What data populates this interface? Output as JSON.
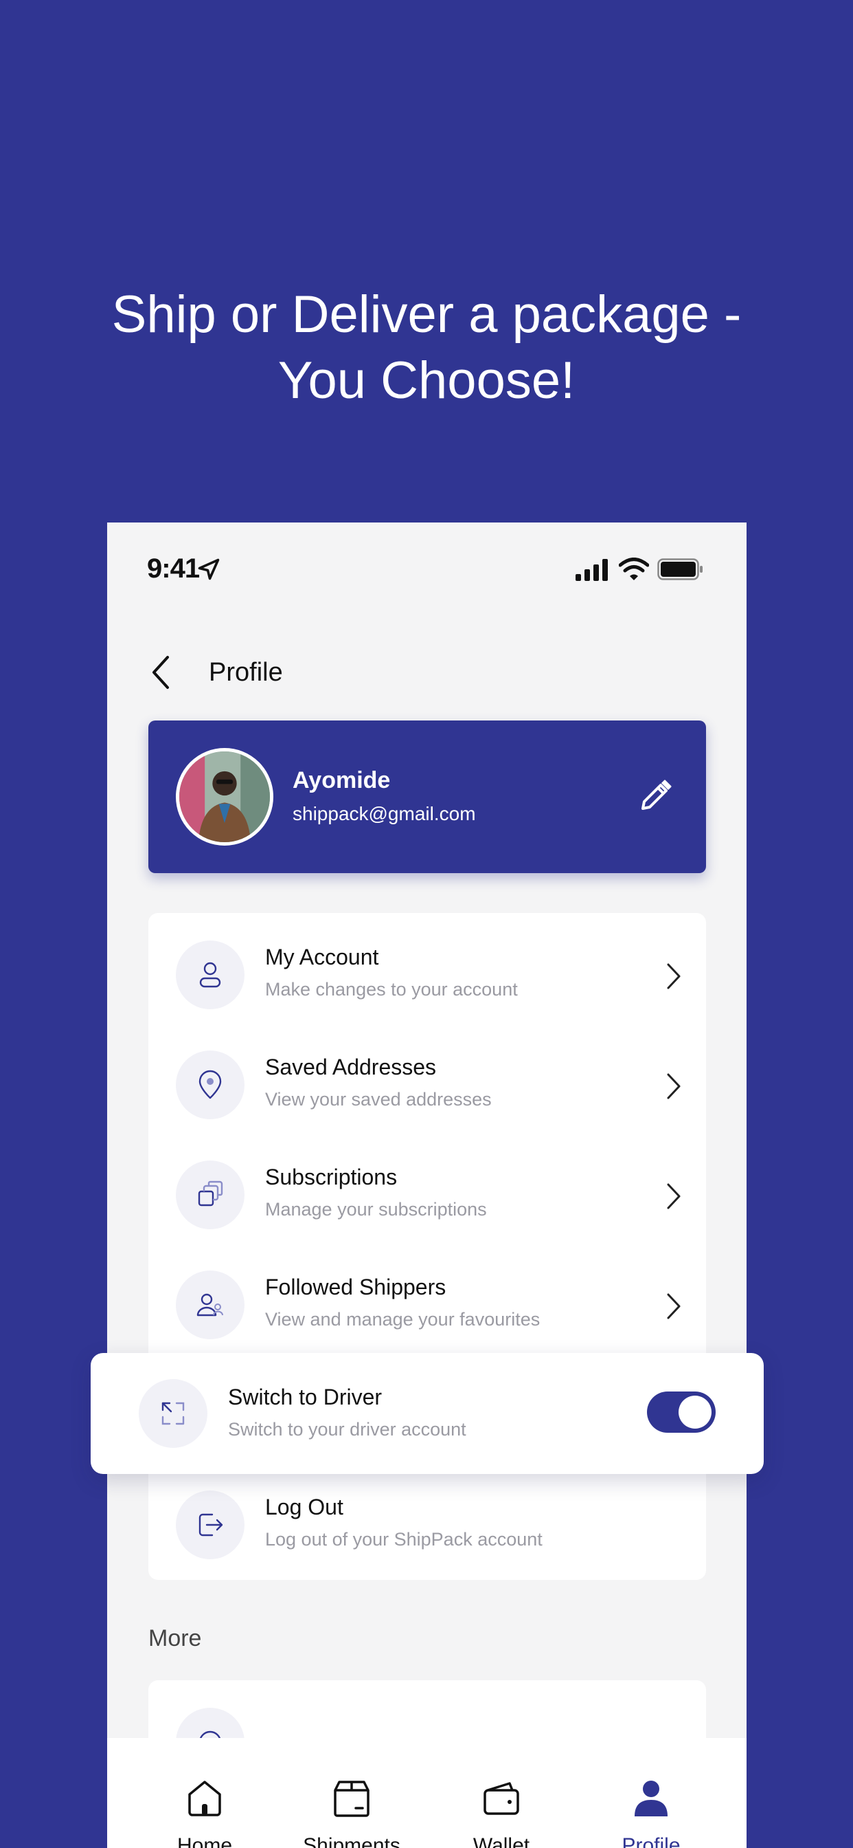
{
  "headline": {
    "line1": "Ship or Deliver a package -",
    "line2": "You Choose!"
  },
  "status_bar": {
    "time": "9:41",
    "icons": [
      "location-arrow-icon",
      "signal-icon",
      "wifi-icon",
      "battery-icon"
    ]
  },
  "navbar": {
    "back_icon": "chevron-left-icon",
    "title": "Profile"
  },
  "profile": {
    "name": "Ayomide",
    "email": "shippack@gmail.com",
    "edit_icon": "pencil-icon"
  },
  "menu": {
    "items": [
      {
        "title": "My Account",
        "subtitle": "Make changes to your account",
        "icon": "user-icon"
      },
      {
        "title": "Saved Addresses",
        "subtitle": "View your saved addresses",
        "icon": "location-pin-icon"
      },
      {
        "title": "Subscriptions",
        "subtitle": "Manage your subscriptions",
        "icon": "stacked-cards-icon"
      },
      {
        "title": "Followed Shippers",
        "subtitle": "View and manage your favourites",
        "icon": "people-icon"
      },
      {
        "title": "Log Out",
        "subtitle": "Log out of your ShipPack account",
        "icon": "logout-icon"
      }
    ]
  },
  "switch_driver": {
    "title": "Switch to Driver",
    "subtitle": "Switch to your driver account",
    "icon": "switch-arrows-icon",
    "enabled": true
  },
  "more": {
    "label": "More"
  },
  "tabs": [
    {
      "label": "Home",
      "icon": "home-icon",
      "active": false
    },
    {
      "label": "Shipments",
      "icon": "box-icon",
      "active": false
    },
    {
      "label": "Wallet",
      "icon": "wallet-icon",
      "active": false
    },
    {
      "label": "Profile",
      "icon": "person-icon",
      "active": true
    }
  ],
  "colors": {
    "brand": "#303592",
    "background_light": "#f4f4f5",
    "muted_text": "#9a9aa2"
  }
}
